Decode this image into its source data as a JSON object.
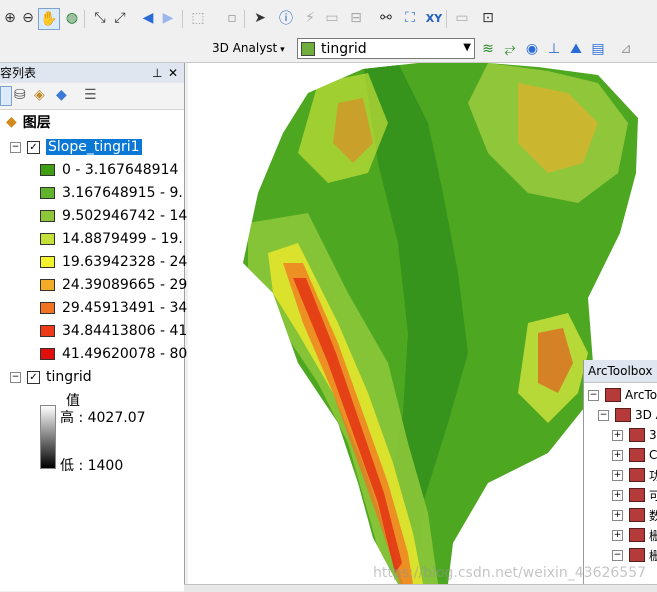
{
  "toolbar": {
    "analyst_label": "3D Analyst",
    "layer_select": "tingrid"
  },
  "toc": {
    "title": "容列表",
    "layers_root": "图层",
    "slope_layer": {
      "name": "Slope_tingri1",
      "classes": [
        {
          "label": "0 - 3.167648914",
          "color": "#3f9e14"
        },
        {
          "label": "3.167648915 - 9.",
          "color": "#62b32c"
        },
        {
          "label": "9.502946742 - 14",
          "color": "#8dc63a"
        },
        {
          "label": "14.8879499 - 19.",
          "color": "#c3df3a"
        },
        {
          "label": "19.63942328 - 24",
          "color": "#f4f22c"
        },
        {
          "label": "24.39089665 - 29",
          "color": "#f2ac28"
        },
        {
          "label": "29.45913491 - 34",
          "color": "#f27422"
        },
        {
          "label": "34.84413806 - 41",
          "color": "#ee3a19"
        },
        {
          "label": "41.49620078 - 80",
          "color": "#e10e0e"
        }
      ]
    },
    "tin_layer": {
      "name": "tingrid",
      "value_label": "值",
      "high_label": "高 : 4027.07",
      "low_label": "低 : 1400"
    }
  },
  "arctoolbox": {
    "title": "ArcToolbox",
    "root": "ArcTool",
    "child": "3D A",
    "items": [
      "3",
      "C",
      "功",
      "可",
      "数",
      "栅",
      "栅"
    ]
  },
  "watermark": "https://blog.csdn.net/weixin_43626557"
}
